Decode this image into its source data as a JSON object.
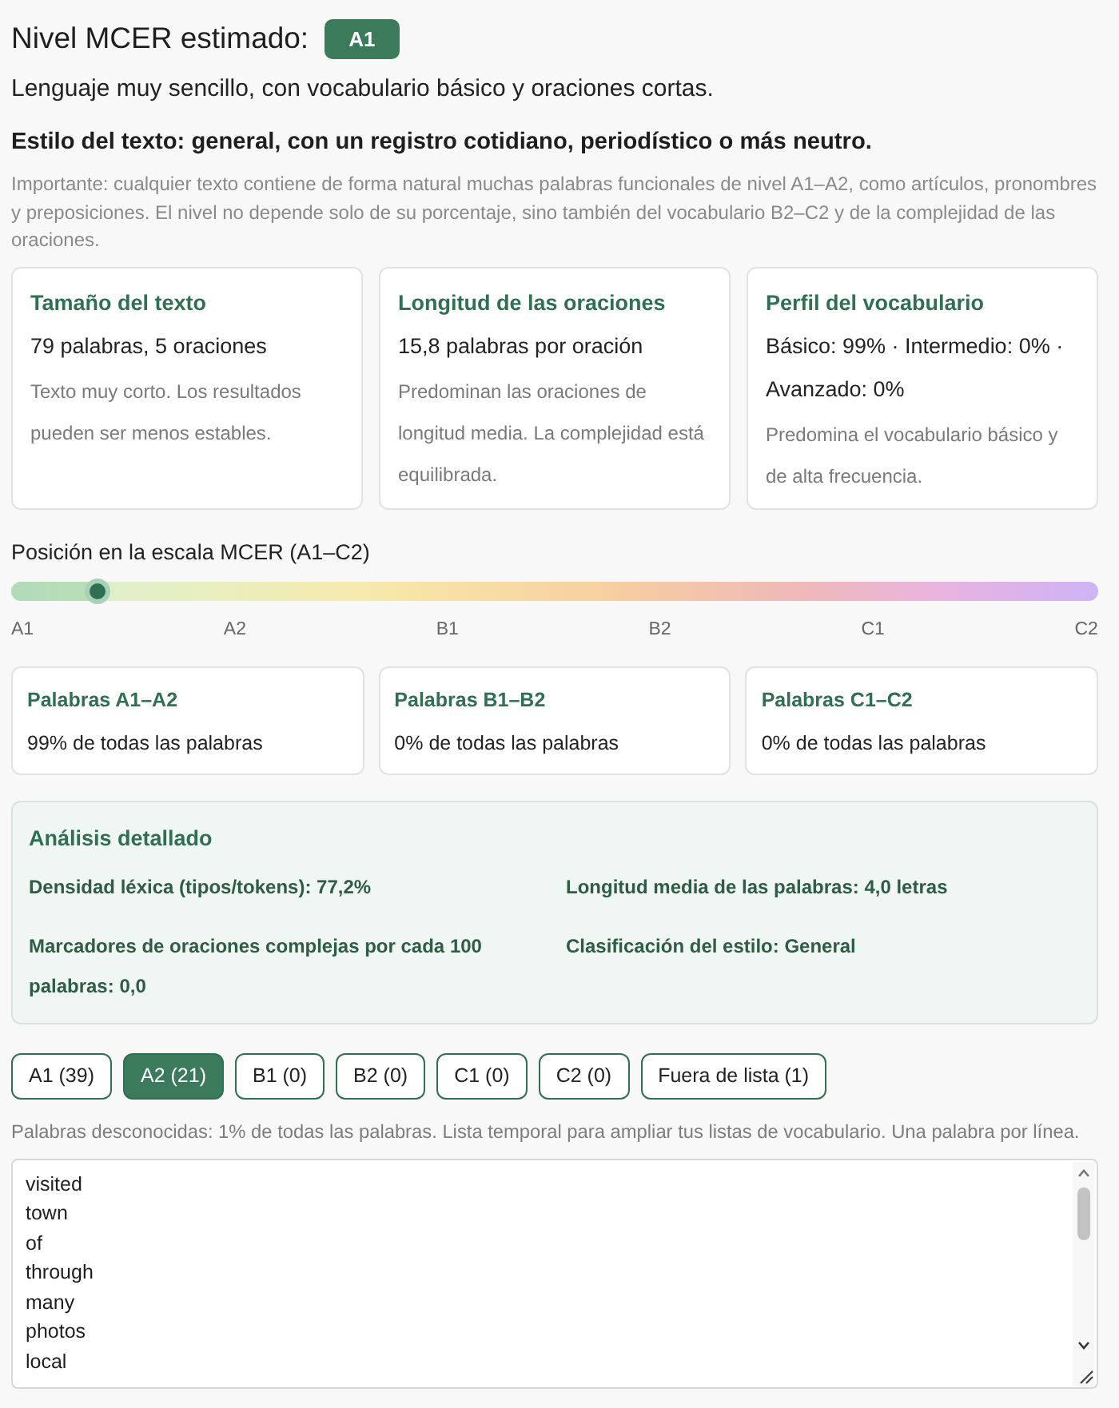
{
  "header": {
    "title": "Nivel MCER estimado:",
    "badge": "A1"
  },
  "summary": "Lenguaje muy sencillo, con vocabulario básico y oraciones cortas.",
  "style_line": "Estilo del texto: general, con un registro cotidiano, periodístico o más neutro.",
  "note": "Importante: cualquier texto contiene de forma natural muchas palabras funcionales de nivel A1–A2, como artículos, pronombres y preposiciones. El nivel no depende solo de su porcentaje, sino también del vocabulario B2–C2 y de la complejidad de las oraciones.",
  "stat_cards": [
    {
      "title": "Tamaño del texto",
      "value": "79 palabras, 5 oraciones",
      "note": "Texto muy corto. Los resultados pueden ser menos estables."
    },
    {
      "title": "Longitud de las oraciones",
      "value": "15,8 palabras por oración",
      "note": "Predominan las oraciones de longitud media. La complejidad está equilibrada."
    },
    {
      "title": "Perfil del vocabulario",
      "value": "Básico: 99% · Intermedio: 0% · Avanzado: 0%",
      "note": "Predomina el vocabulario básico y de alta frecuencia."
    }
  ],
  "scale": {
    "label": "Posición en la escala MCER (A1–C2)",
    "level": 0.08,
    "ticks": [
      "A1",
      "A2",
      "B1",
      "B2",
      "C1",
      "C2"
    ]
  },
  "word_share_cards": [
    {
      "title": "Palabras A1–A2",
      "value": "99% de todas las palabras"
    },
    {
      "title": "Palabras B1–B2",
      "value": "0% de todas las palabras"
    },
    {
      "title": "Palabras C1–C2",
      "value": "0% de todas las palabras"
    }
  ],
  "analysis": {
    "title": "Análisis detallado",
    "items": [
      "Densidad léxica (tipos/tokens): 77,2%",
      "Longitud media de las palabras: 4,0 letras",
      "Marcadores de oraciones complejas por cada 100 palabras: 0,0",
      "Clasificación del estilo: General"
    ]
  },
  "level_tabs": [
    {
      "label": "A1 (39)",
      "selected": false
    },
    {
      "label": "A2 (21)",
      "selected": true
    },
    {
      "label": "B1 (0)",
      "selected": false
    },
    {
      "label": "B2 (0)",
      "selected": false
    },
    {
      "label": "C1 (0)",
      "selected": false
    },
    {
      "label": "C2 (0)",
      "selected": false
    },
    {
      "label": "Fuera de lista (1)",
      "selected": false
    }
  ],
  "word_list": {
    "description": "Palabras desconocidas: 1% de todas las palabras. Lista temporal para ampliar tus listas de vocabulario. Una palabra por línea.",
    "lines": [
      "visited",
      "town",
      "of",
      "through",
      "many",
      "photos",
      "local"
    ]
  }
}
